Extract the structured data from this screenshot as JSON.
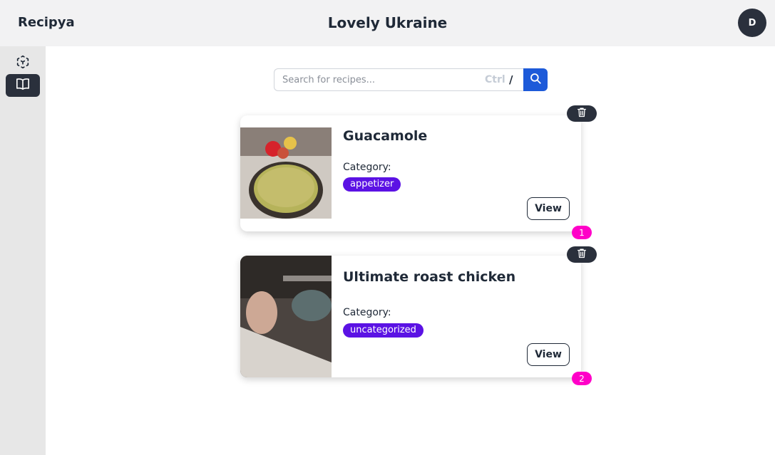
{
  "header": {
    "brand": "Recipya",
    "title": "Lovely Ukraine",
    "avatar_initial": "D"
  },
  "sidebar": {
    "items": [
      {
        "icon": "cube-icon",
        "active": false
      },
      {
        "icon": "book-open-icon",
        "active": true
      }
    ]
  },
  "search": {
    "placeholder": "Search for recipes...",
    "value": "",
    "shortcut_ctrl": "Ctrl",
    "shortcut_key": "/"
  },
  "recipes": [
    {
      "title": "Guacamole",
      "category_label": "Category:",
      "category": "appetizer",
      "view_label": "View",
      "index": "1"
    },
    {
      "title": "Ultimate roast chicken",
      "category_label": "Category:",
      "category": "uncategorized",
      "view_label": "View",
      "index": "2"
    }
  ],
  "colors": {
    "accent_blue": "#1d5ad9",
    "category_badge": "#5b12e4",
    "index_badge": "#ff00c8",
    "dark": "#2a303c"
  }
}
